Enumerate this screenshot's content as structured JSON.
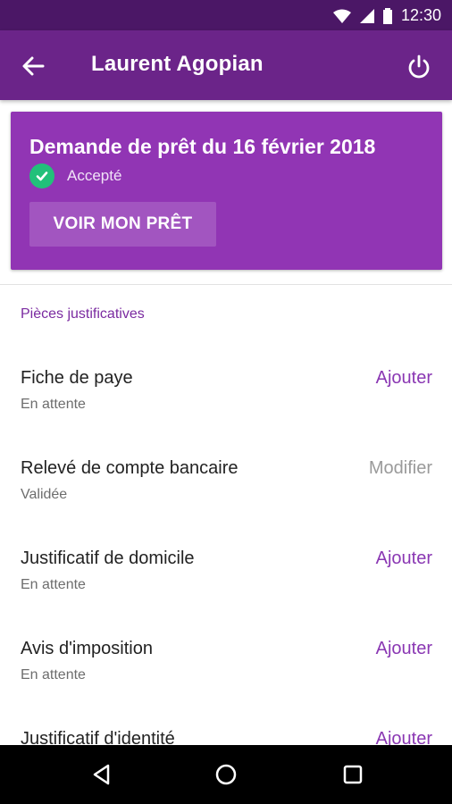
{
  "status_bar": {
    "time": "12:30"
  },
  "app_bar": {
    "title": "Laurent Agopian"
  },
  "loan_card": {
    "title": "Demande de prêt du 16 février 2018",
    "status": "Accepté",
    "button_label": "VOIR MON PRÊT"
  },
  "documents": {
    "section_title": "Pièces justificatives",
    "items": [
      {
        "name": "Fiche de paye",
        "status": "En attente",
        "action": "Ajouter"
      },
      {
        "name": "Relevé de compte bancaire",
        "status": "Validée",
        "action": "Modifier"
      },
      {
        "name": "Justificatif de domicile",
        "status": "En attente",
        "action": "Ajouter"
      },
      {
        "name": "Avis d'imposition",
        "status": "En attente",
        "action": "Ajouter"
      },
      {
        "name": "Justificatif d'identité",
        "status": "",
        "action": "Ajouter"
      }
    ]
  },
  "colors": {
    "status_bar": "#4b1766",
    "app_bar": "#6b2489",
    "card": "#9135b4",
    "accent": "#8a37b3",
    "success": "#22c07a"
  },
  "icons": [
    "wifi-icon",
    "signal-icon",
    "battery-icon",
    "back-arrow-icon",
    "power-icon",
    "check-icon",
    "nav-back-icon",
    "nav-home-icon",
    "nav-recents-icon"
  ]
}
